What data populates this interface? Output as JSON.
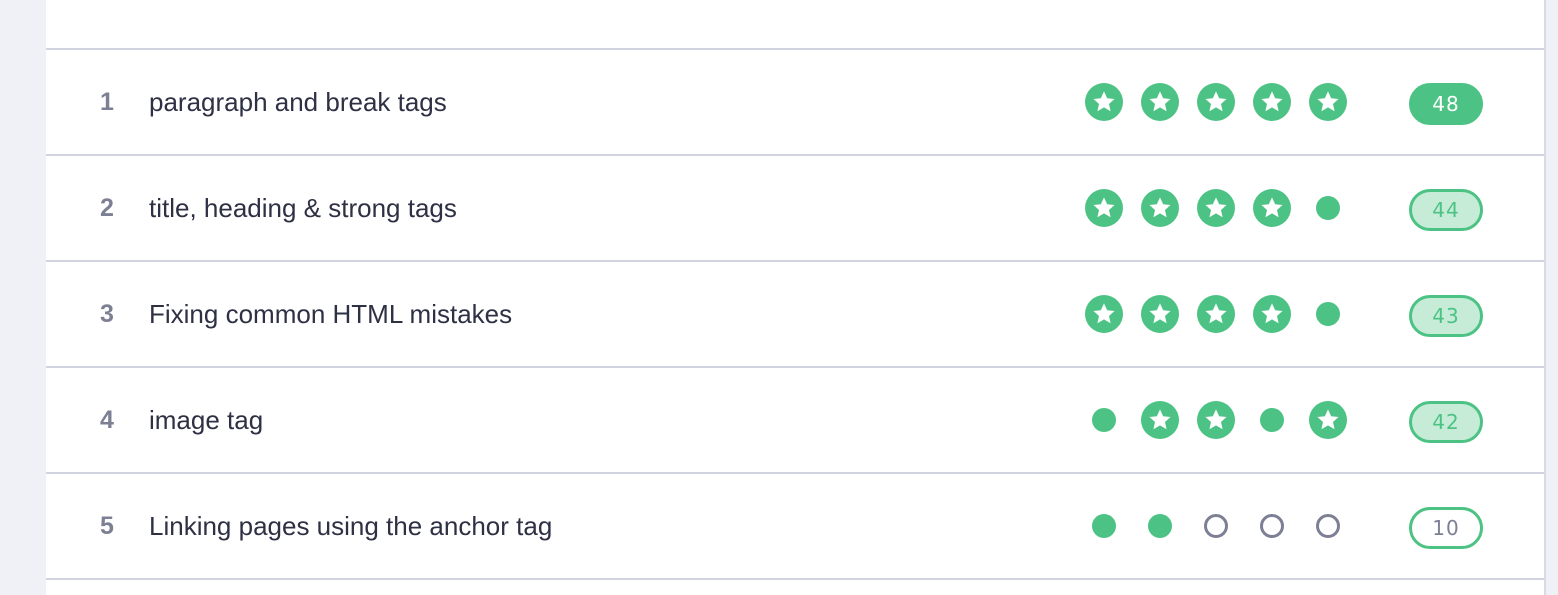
{
  "colors": {
    "accent": "#4cc384",
    "accent_light": "#c6ecd7",
    "muted": "#7d8095",
    "text": "#2e3044",
    "divider": "#d2d5e1",
    "background": "#eff1f7"
  },
  "lessons": [
    {
      "number": "1",
      "title": "paragraph and break tags",
      "marks": [
        "star",
        "star",
        "star",
        "star",
        "star"
      ],
      "score": "48",
      "score_style": "full"
    },
    {
      "number": "2",
      "title": "title, heading & strong tags",
      "marks": [
        "star",
        "star",
        "star",
        "star",
        "dot"
      ],
      "score": "44",
      "score_style": "partial"
    },
    {
      "number": "3",
      "title": "Fixing common HTML mistakes",
      "marks": [
        "star",
        "star",
        "star",
        "star",
        "dot"
      ],
      "score": "43",
      "score_style": "partial"
    },
    {
      "number": "4",
      "title": "image tag",
      "marks": [
        "dot",
        "star",
        "star",
        "dot",
        "star"
      ],
      "score": "42",
      "score_style": "partial"
    },
    {
      "number": "5",
      "title": "Linking pages using the anchor tag",
      "marks": [
        "dot",
        "dot",
        "ring",
        "ring",
        "ring"
      ],
      "score": "10",
      "score_style": "low"
    }
  ]
}
